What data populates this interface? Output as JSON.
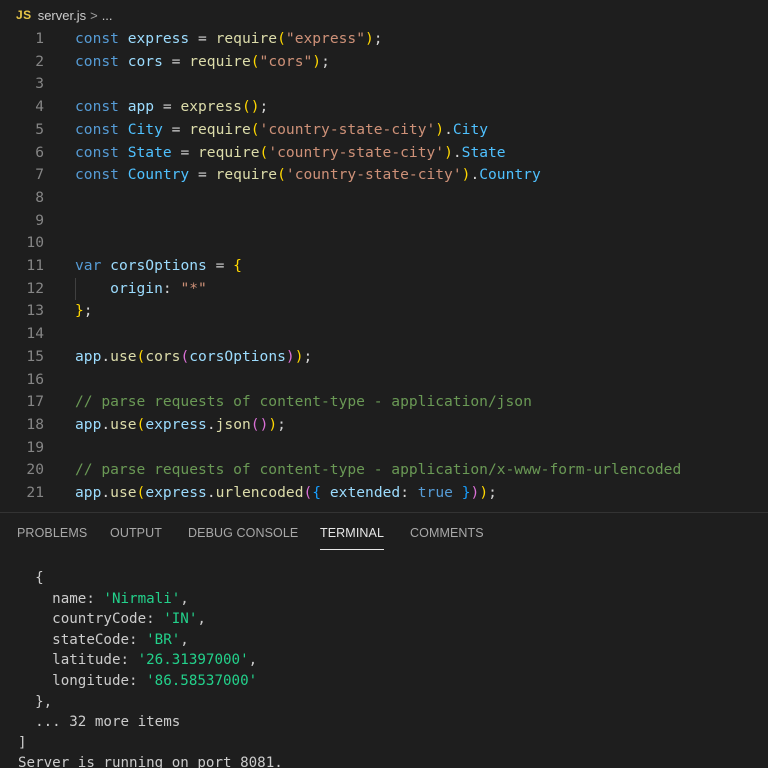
{
  "breadcrumb": {
    "file_badge": "JS",
    "file_name": "server.js",
    "separator": ">",
    "more": "..."
  },
  "editor": {
    "lines": [
      {
        "n": "1",
        "tokens": [
          [
            "kw",
            "const "
          ],
          [
            "var",
            "express"
          ],
          [
            "op",
            " = "
          ],
          [
            "fn",
            "require"
          ],
          [
            "p1",
            "("
          ],
          [
            "str",
            "\"express\""
          ],
          [
            "p1",
            ")"
          ],
          [
            "op",
            ";"
          ]
        ]
      },
      {
        "n": "2",
        "tokens": [
          [
            "kw",
            "const "
          ],
          [
            "var",
            "cors"
          ],
          [
            "op",
            " = "
          ],
          [
            "fn",
            "require"
          ],
          [
            "p1",
            "("
          ],
          [
            "str",
            "\"cors\""
          ],
          [
            "p1",
            ")"
          ],
          [
            "op",
            ";"
          ]
        ]
      },
      {
        "n": "3",
        "tokens": []
      },
      {
        "n": "4",
        "tokens": [
          [
            "kw",
            "const "
          ],
          [
            "var",
            "app"
          ],
          [
            "op",
            " = "
          ],
          [
            "fn",
            "express"
          ],
          [
            "p1",
            "()"
          ],
          [
            "op",
            ";"
          ]
        ]
      },
      {
        "n": "5",
        "tokens": [
          [
            "kw",
            "const "
          ],
          [
            "cst",
            "City"
          ],
          [
            "op",
            " = "
          ],
          [
            "fn",
            "require"
          ],
          [
            "p1",
            "("
          ],
          [
            "str",
            "'country-state-city'"
          ],
          [
            "p1",
            ")"
          ],
          [
            "op",
            "."
          ],
          [
            "cst",
            "City"
          ]
        ]
      },
      {
        "n": "6",
        "tokens": [
          [
            "kw",
            "const "
          ],
          [
            "cst",
            "State"
          ],
          [
            "op",
            " = "
          ],
          [
            "fn",
            "require"
          ],
          [
            "p1",
            "("
          ],
          [
            "str",
            "'country-state-city'"
          ],
          [
            "p1",
            ")"
          ],
          [
            "op",
            "."
          ],
          [
            "cst",
            "State"
          ]
        ]
      },
      {
        "n": "7",
        "tokens": [
          [
            "kw",
            "const "
          ],
          [
            "cst",
            "Country"
          ],
          [
            "op",
            " = "
          ],
          [
            "fn",
            "require"
          ],
          [
            "p1",
            "("
          ],
          [
            "str",
            "'country-state-city'"
          ],
          [
            "p1",
            ")"
          ],
          [
            "op",
            "."
          ],
          [
            "cst",
            "Country"
          ]
        ]
      },
      {
        "n": "8",
        "tokens": []
      },
      {
        "n": "9",
        "tokens": []
      },
      {
        "n": "10",
        "tokens": []
      },
      {
        "n": "11",
        "tokens": [
          [
            "kw",
            "var "
          ],
          [
            "var",
            "corsOptions"
          ],
          [
            "op",
            " = "
          ],
          [
            "p1",
            "{"
          ]
        ]
      },
      {
        "n": "12",
        "tokens": [
          [
            "op",
            "    "
          ],
          [
            "var",
            "origin"
          ],
          [
            "op",
            ": "
          ],
          [
            "str",
            "\"*\""
          ]
        ],
        "guide": true
      },
      {
        "n": "13",
        "tokens": [
          [
            "p1",
            "}"
          ],
          [
            "op",
            ";"
          ]
        ]
      },
      {
        "n": "14",
        "tokens": []
      },
      {
        "n": "15",
        "tokens": [
          [
            "var",
            "app"
          ],
          [
            "op",
            "."
          ],
          [
            "fn",
            "use"
          ],
          [
            "p1",
            "("
          ],
          [
            "fn",
            "cors"
          ],
          [
            "p2",
            "("
          ],
          [
            "var",
            "corsOptions"
          ],
          [
            "p2",
            ")"
          ],
          [
            "p1",
            ")"
          ],
          [
            "op",
            ";"
          ]
        ]
      },
      {
        "n": "16",
        "tokens": []
      },
      {
        "n": "17",
        "tokens": [
          [
            "cmt",
            "// parse requests of content-type - application/json"
          ]
        ]
      },
      {
        "n": "18",
        "tokens": [
          [
            "var",
            "app"
          ],
          [
            "op",
            "."
          ],
          [
            "fn",
            "use"
          ],
          [
            "p1",
            "("
          ],
          [
            "var",
            "express"
          ],
          [
            "op",
            "."
          ],
          [
            "fn",
            "json"
          ],
          [
            "p2",
            "()"
          ],
          [
            "p1",
            ")"
          ],
          [
            "op",
            ";"
          ]
        ]
      },
      {
        "n": "19",
        "tokens": []
      },
      {
        "n": "20",
        "tokens": [
          [
            "cmt",
            "// parse requests of content-type - application/x-www-form-urlencoded"
          ]
        ]
      },
      {
        "n": "21",
        "tokens": [
          [
            "var",
            "app"
          ],
          [
            "op",
            "."
          ],
          [
            "fn",
            "use"
          ],
          [
            "p1",
            "("
          ],
          [
            "var",
            "express"
          ],
          [
            "op",
            "."
          ],
          [
            "fn",
            "urlencoded"
          ],
          [
            "p2",
            "("
          ],
          [
            "p3",
            "{"
          ],
          [
            "op",
            " "
          ],
          [
            "var",
            "extended"
          ],
          [
            "op",
            ": "
          ],
          [
            "kw",
            "true"
          ],
          [
            "op",
            " "
          ],
          [
            "p3",
            "}"
          ],
          [
            "p2",
            ")"
          ],
          [
            "p1",
            ")"
          ],
          [
            "op",
            ";"
          ]
        ]
      }
    ]
  },
  "panel": {
    "tabs": [
      {
        "label": "PROBLEMS",
        "active": false
      },
      {
        "label": "OUTPUT",
        "active": false
      },
      {
        "label": "DEBUG CONSOLE",
        "active": false
      },
      {
        "label": "TERMINAL",
        "active": true
      },
      {
        "label": "COMMENTS",
        "active": false
      }
    ]
  },
  "terminal": {
    "lines": [
      [
        [
          "t",
          "  {"
        ]
      ],
      [
        [
          "t",
          "    name: "
        ],
        [
          "s",
          "'Nirmali'"
        ],
        [
          "t",
          ","
        ]
      ],
      [
        [
          "t",
          "    countryCode: "
        ],
        [
          "s",
          "'IN'"
        ],
        [
          "t",
          ","
        ]
      ],
      [
        [
          "t",
          "    stateCode: "
        ],
        [
          "s",
          "'BR'"
        ],
        [
          "t",
          ","
        ]
      ],
      [
        [
          "t",
          "    latitude: "
        ],
        [
          "s",
          "'26.31397000'"
        ],
        [
          "t",
          ","
        ]
      ],
      [
        [
          "t",
          "    longitude: "
        ],
        [
          "s",
          "'86.58537000'"
        ]
      ],
      [
        [
          "t",
          "  },"
        ]
      ],
      [
        [
          "t",
          "  ... 32 more items"
        ]
      ],
      [
        [
          "t",
          "]"
        ]
      ],
      [
        [
          "t",
          "Server is running on port 8081."
        ]
      ]
    ]
  },
  "colors": {
    "background": "#1e1e1e",
    "keyword": "#569cd6",
    "variable": "#9cdcfe",
    "constant": "#4fc1ff",
    "function": "#dcdcaa",
    "string": "#ce9178",
    "comment": "#6a9955",
    "terminal_string": "#23d18b"
  }
}
